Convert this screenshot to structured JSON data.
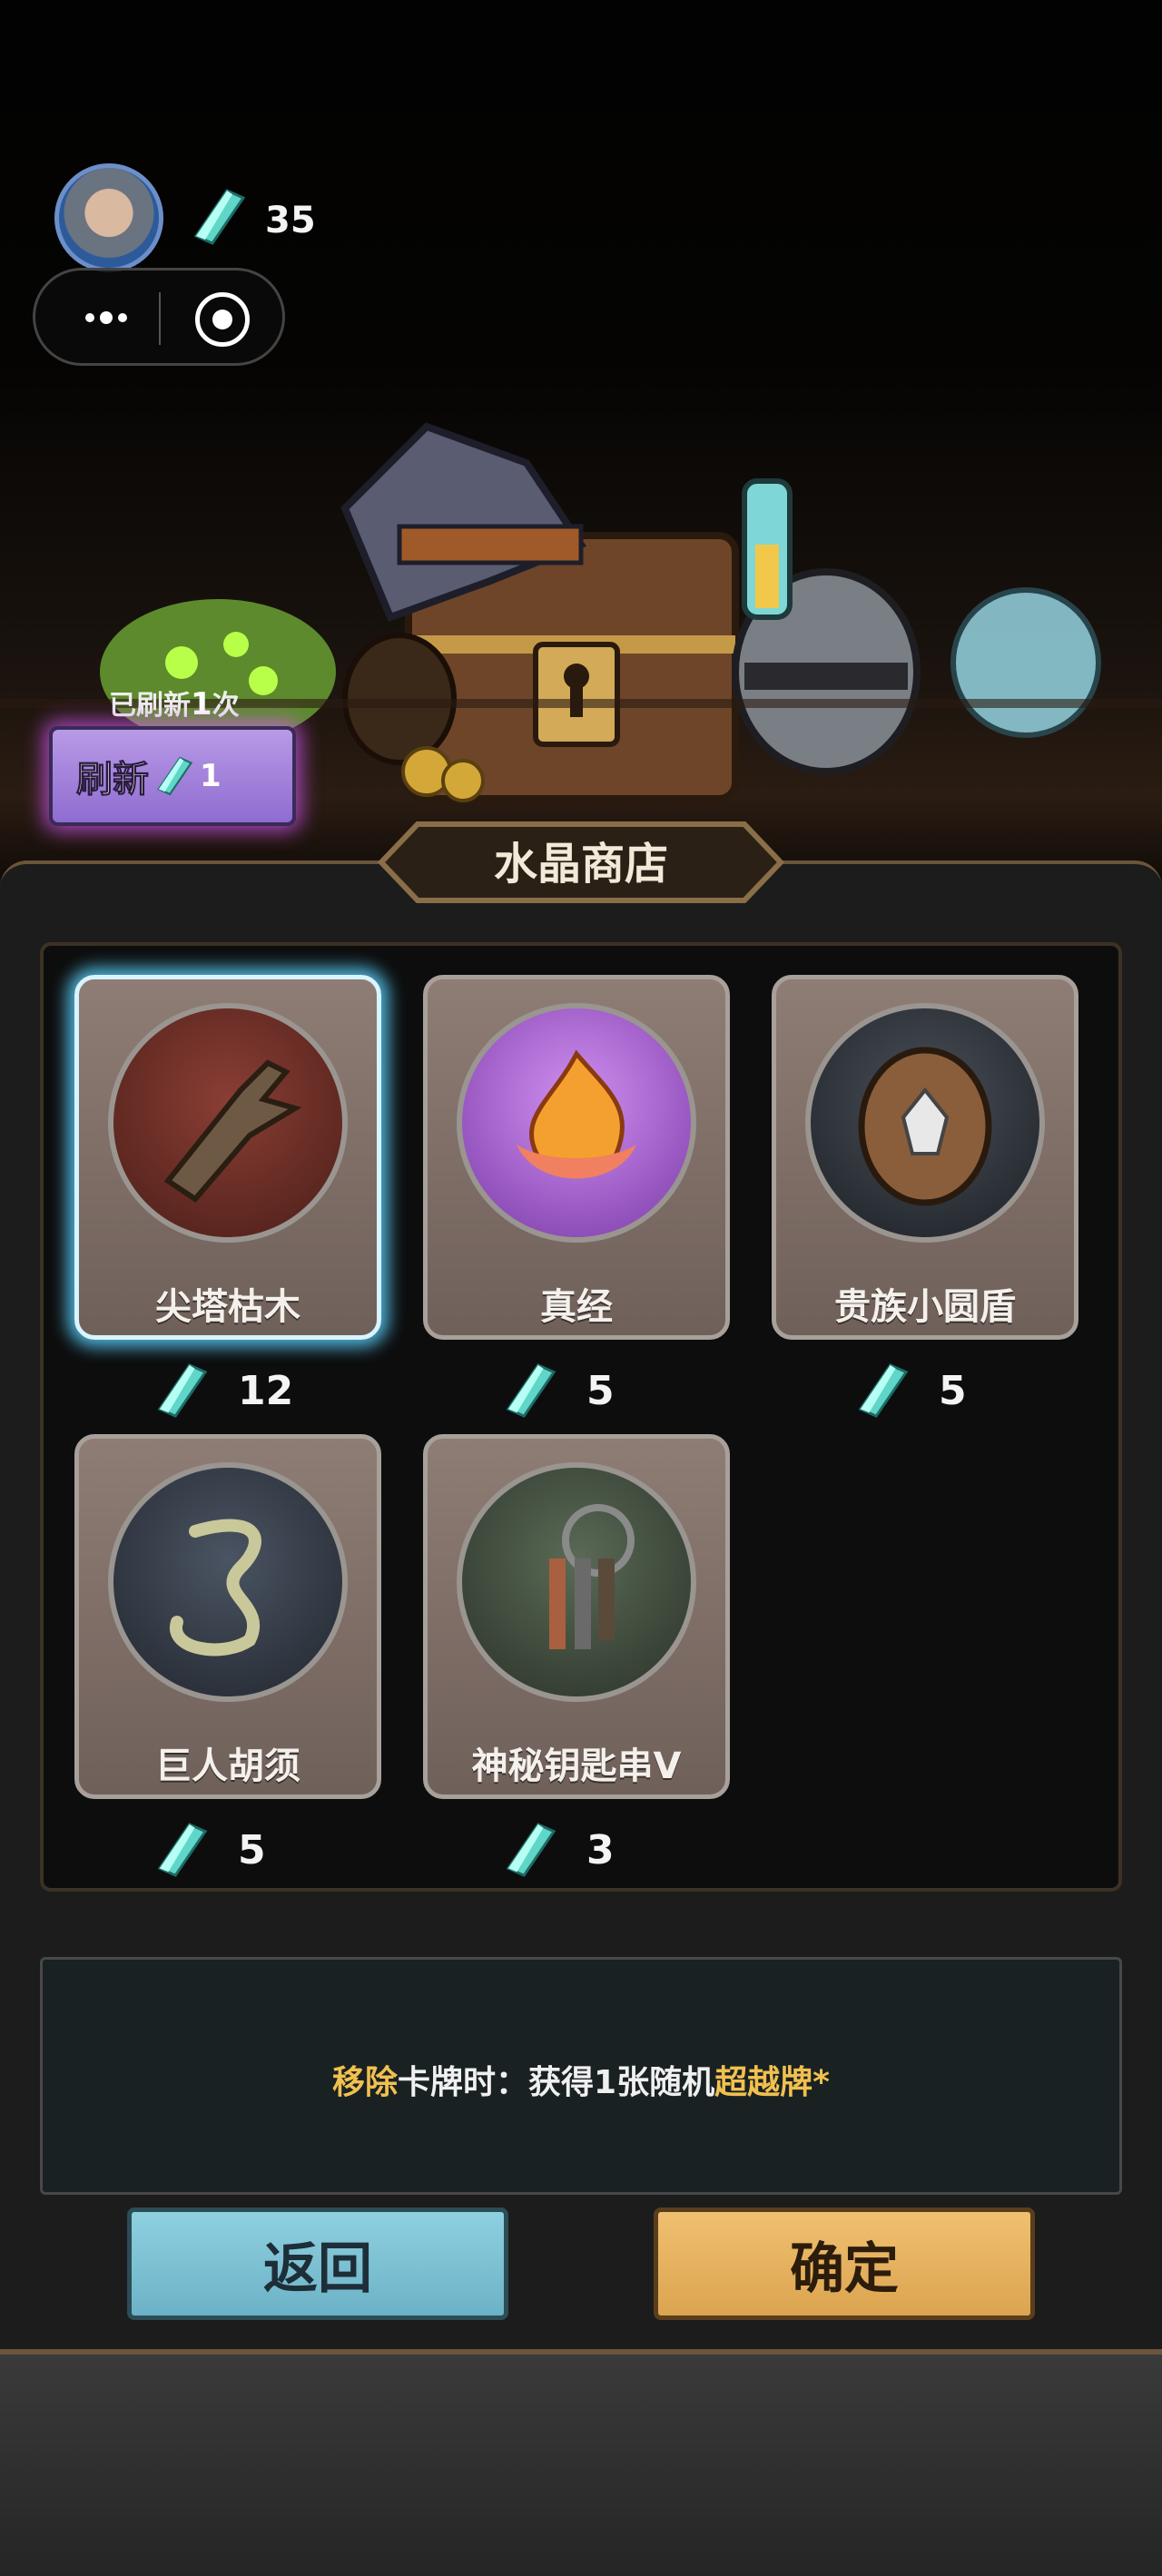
{
  "hud": {
    "avatar_icon": "player-avatar",
    "crystal_icon": "crystal-icon",
    "crystal_count": "35",
    "menu_icon": "more-dots-icon",
    "close_icon": "target-circle-icon"
  },
  "shop": {
    "refresh_note_prefix": "已刷新",
    "refresh_note_count": "1",
    "refresh_note_suffix": "次",
    "refresh_label": "刷新",
    "refresh_cost": "1",
    "title": "水晶商店"
  },
  "items": [
    {
      "name": "尖塔枯木",
      "price": "12",
      "icon": "dead-wood-icon",
      "orb_color": "#6a2e26",
      "selected": true
    },
    {
      "name": "真经",
      "price": "5",
      "icon": "flame-lotus-icon",
      "orb_color": "#a060c8",
      "selected": false
    },
    {
      "name": "贵族小圆盾",
      "price": "5",
      "icon": "round-shield-icon",
      "orb_color": "#2c3038",
      "selected": false
    },
    {
      "name": "巨人胡须",
      "price": "5",
      "icon": "giant-beard-icon",
      "orb_color": "#2f3540",
      "selected": false
    },
    {
      "name": "神秘钥匙串V",
      "price": "3",
      "icon": "key-ring-icon",
      "orb_color": "#3c4a3a",
      "selected": false
    }
  ],
  "description": {
    "part1": "移除",
    "part2": "卡牌时：获得1张随机",
    "part3": "超越牌",
    "part4": "*"
  },
  "buttons": {
    "back": "返回",
    "confirm": "确定"
  },
  "colors": {
    "highlight": "#f0c050",
    "refresh_glow": "#dc5aff",
    "selected_glow": "#5ad2ff"
  }
}
